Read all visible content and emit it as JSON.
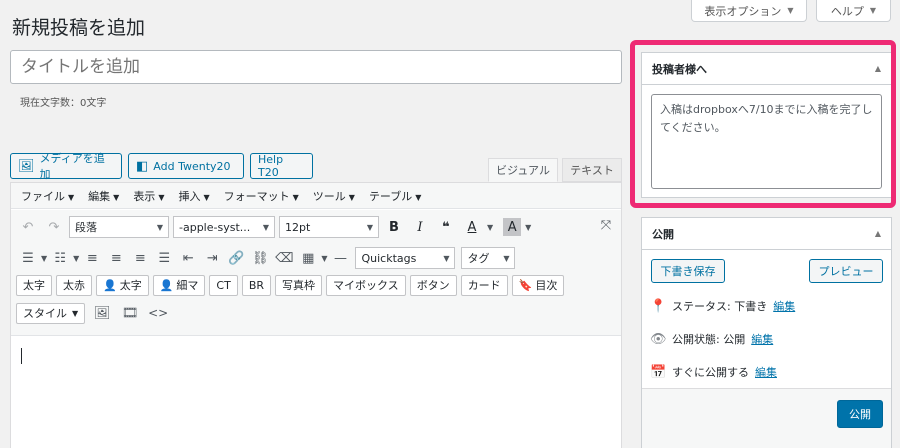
{
  "header": {
    "title": "新規投稿を追加",
    "screen_options": "表示オプション",
    "help": "ヘルプ"
  },
  "title_field": {
    "placeholder": "タイトルを追加",
    "char_count": "現在文字数：0文字"
  },
  "media_buttons": [
    {
      "label": "メディアを追加",
      "icon": "media-icon"
    },
    {
      "label": "Add Twenty20",
      "icon": "twenty20-icon"
    },
    {
      "label": "Help T20"
    }
  ],
  "editor_tabs": {
    "visual": "ビジュアル",
    "text": "テキスト"
  },
  "menubar": [
    "ファイル",
    "編集",
    "表示",
    "挿入",
    "フォーマット",
    "ツール",
    "テーブル"
  ],
  "toolbar": {
    "paragraph": "段落",
    "font_family": "-apple-syst...",
    "font_size": "12pt",
    "quicktags": "Quicktags",
    "tag": "タグ",
    "style": "スタイル"
  },
  "quick_buttons": [
    "太字",
    "太赤",
    "太字",
    "細マ",
    "CT",
    "BR",
    "写真枠",
    "マイボックス",
    "ボタン",
    "カード",
    "目次"
  ],
  "sidebar": {
    "memo_box": {
      "title": "投稿者様へ",
      "text": "入稿はdropboxへ7/10までに入稿を完了してください。"
    },
    "publish_box": {
      "title": "公開",
      "save_draft": "下書き保存",
      "preview": "プレビュー",
      "status_label": "ステータス: 下書き",
      "visibility_label": "公開状態: 公開",
      "schedule_label": "すぐに公開する",
      "edit": "編集",
      "publish": "公開"
    }
  },
  "colors": {
    "accent": "#0073aa",
    "highlight": "#ee2a74"
  }
}
